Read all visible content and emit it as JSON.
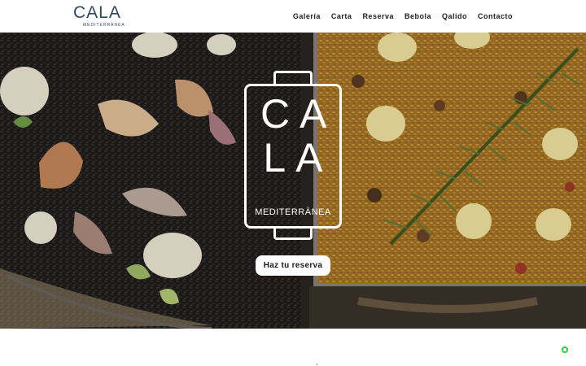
{
  "brand": {
    "name": "CALA",
    "tagline": "MEDITERRÀNEA",
    "color": "#2d4a63"
  },
  "nav": {
    "items": [
      {
        "label": "Galería"
      },
      {
        "label": "Carta"
      },
      {
        "label": "Reserva"
      },
      {
        "label": "Bebola"
      },
      {
        "label": "Qalido"
      },
      {
        "label": "Contacto"
      }
    ]
  },
  "hero": {
    "emblem": {
      "line1": "CA",
      "line2": "LA",
      "subtitle": "MEDITERRÀNEA"
    },
    "cta_label": "Haz tu reserva",
    "colors": {
      "black_rice": "#1f1d1c",
      "yellow_rice": "#b8892e",
      "aioli": "#f7f1d8",
      "rosemary": "#4b6a2c"
    }
  },
  "chat": {
    "icon": "whatsapp-icon",
    "color": "#2ecc40"
  }
}
